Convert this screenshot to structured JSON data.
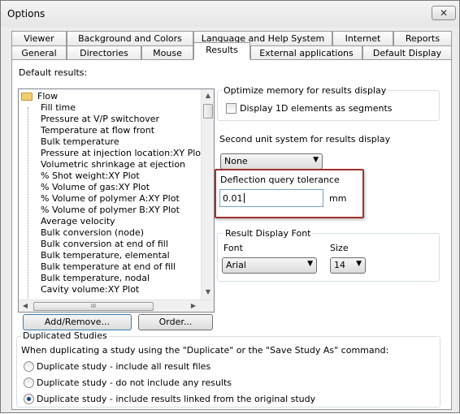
{
  "window": {
    "title": "Options",
    "close_symbol": "✕"
  },
  "tabs_row1": [
    "Viewer",
    "Background and Colors",
    "Language and Help System",
    "Internet",
    "Reports"
  ],
  "tabs_row2": [
    "General",
    "Directories",
    "Mouse",
    "Results",
    "External applications",
    "Default Display"
  ],
  "active_tab": "Results",
  "default_results": {
    "label": "Default results:",
    "root": "Flow",
    "items": [
      "Fill time",
      "Pressure at V/P switchover",
      "Temperature at flow front",
      "Bulk temperature",
      "Pressure at injection location:XY Plot",
      "Volumetric shrinkage at ejection",
      "% Shot weight:XY Plot",
      "% Volume of gas:XY Plot",
      "% Volume of polymer A:XY Plot",
      "% Volume of polymer B:XY Plot",
      "Average velocity",
      "Bulk conversion (node)",
      "Bulk conversion at end of fill",
      "Bulk temperature, elemental",
      "Bulk temperature at end of fill",
      "Bulk temperature, nodal",
      "Cavity volume:XY Plot"
    ],
    "scroll_grip": "III"
  },
  "buttons": {
    "add_remove": "Add/Remove...",
    "order": "Order..."
  },
  "optimize_memory": {
    "title": "Optimize memory for results display",
    "checkbox_label": "Display 1D elements as segments",
    "checked": false
  },
  "second_unit": {
    "label": "Second unit system for results display",
    "value": "None"
  },
  "deflection": {
    "label": "Deflection query tolerance",
    "value": "0.01",
    "unit": "mm"
  },
  "font_group": {
    "title": "Result Display Font",
    "font_label": "Font",
    "font_value": "Arial",
    "size_label": "Size",
    "size_value": "14"
  },
  "duplicated": {
    "title": "Duplicated Studies",
    "description": "When duplicating a study using the \"Duplicate\" or the \"Save Study As\" command:",
    "options": [
      "Duplicate study - include all result files",
      "Duplicate study - do not include any results",
      "Duplicate study - include results linked from the original study"
    ],
    "selected_index": 2
  },
  "colors": {
    "highlight_border": "#a0322e",
    "radio_dot": "#1c3f94"
  }
}
